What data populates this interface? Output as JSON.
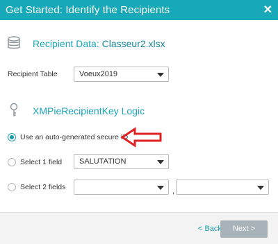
{
  "header": {
    "title": "Get Started: Identify the Recipients",
    "close_label": "✕"
  },
  "recipient_data": {
    "prefix": "Recipient Data: ",
    "filename": "Classeur2.xlsx"
  },
  "recipient_table": {
    "label": "Recipient Table",
    "value": "Voeux2019"
  },
  "key_logic": {
    "title": "XMPieRecipientKey Logic"
  },
  "options": {
    "auto": {
      "label": "Use an auto-generated secure ID",
      "checked": true
    },
    "one_field": {
      "label": "Select 1 field",
      "value": "SALUTATION"
    },
    "two_fields": {
      "label": "Select 2 fields",
      "value_1": "",
      "value_2": "",
      "separator": ","
    }
  },
  "footer": {
    "back_label": "< Back",
    "next_label": "Next >"
  },
  "colors": {
    "accent": "#17a8ba",
    "annotation": "#e02020",
    "next_disabled": "#a8b3b9"
  }
}
